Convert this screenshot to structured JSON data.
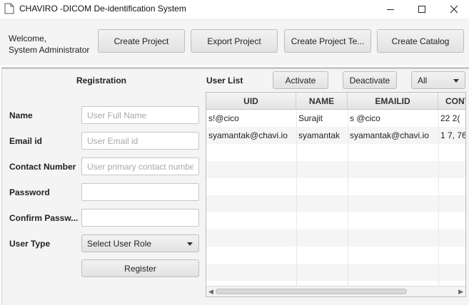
{
  "window": {
    "title": "CHAVIRO -DICOM De-identification System",
    "minimize_glyph": "—",
    "maximize_glyph": "☐",
    "close_glyph": "✕"
  },
  "header": {
    "welcome_line1": "Welcome,",
    "welcome_line2": "System Administrator",
    "buttons": {
      "create_project": "Create Project",
      "export_project": "Export Project",
      "create_project_template": "Create Project Te...",
      "create_catalog": "Create Catalog"
    }
  },
  "registration": {
    "title": "Registration",
    "name_label": "Name",
    "name_placeholder": "User Full Name",
    "email_label": "Email id",
    "email_placeholder": "User Email id",
    "contact_label": "Contact Number",
    "contact_placeholder": "User primary contact numbe",
    "password_label": "Password",
    "confirm_label": "Confirm Passw...",
    "user_type_label": "User Type",
    "user_type_value": "Select User Role",
    "register_button": "Register"
  },
  "user_list": {
    "title": "User List",
    "activate_button": "Activate",
    "deactivate_button": "Deactivate",
    "filter_value": "All",
    "columns": [
      "UID",
      "NAME",
      "EMAILID",
      "CONT"
    ],
    "rows": [
      [
        "s!@cico ",
        "Surajit",
        "s @cico",
        "22 2("
      ],
      [
        "syamantak@chavi.io",
        "syamantak",
        "syamantak@chavi.io",
        "1 7, 76"
      ]
    ]
  },
  "colors": {
    "background": "#f4f4f4",
    "panel": "#ffffff",
    "border": "#bdbdbd"
  }
}
